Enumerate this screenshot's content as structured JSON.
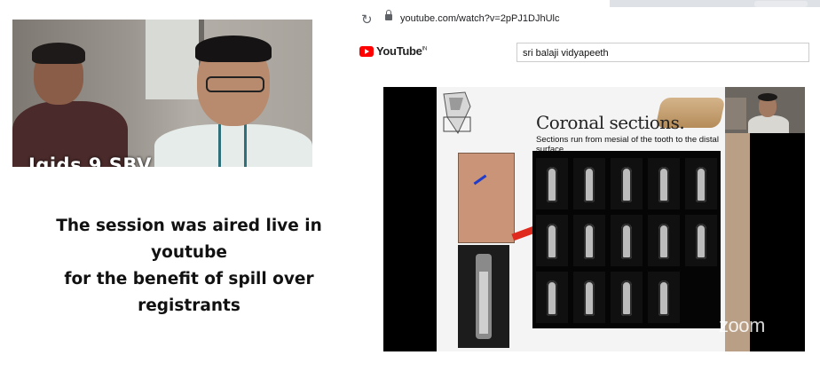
{
  "webcam": {
    "overlay_label": "Igids 9 SBV"
  },
  "caption": {
    "lines": [
      "The session was aired live in youtube",
      "for the benefit of spill over",
      "registrants"
    ]
  },
  "browser": {
    "url": "youtube.com/watch?v=2pPJ1DJhUlc",
    "reload_icon": "reload-icon",
    "lock_icon": "lock-icon"
  },
  "youtube": {
    "logo_text": "YouTube",
    "logo_suffix": "IN",
    "search_value": "sri balaji vidyapeeth"
  },
  "slide": {
    "title": "Coronal sections.",
    "subtitle": "Sections run from mesial of the tooth to the distal surface."
  },
  "video": {
    "watermark": "zoom"
  }
}
